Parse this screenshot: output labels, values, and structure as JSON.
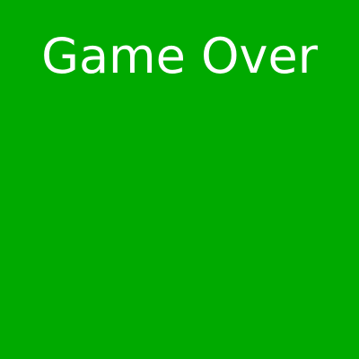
{
  "game": {
    "status_text": "Game Over",
    "colors": {
      "background": "#00aa00",
      "text": "#ffffff"
    }
  }
}
